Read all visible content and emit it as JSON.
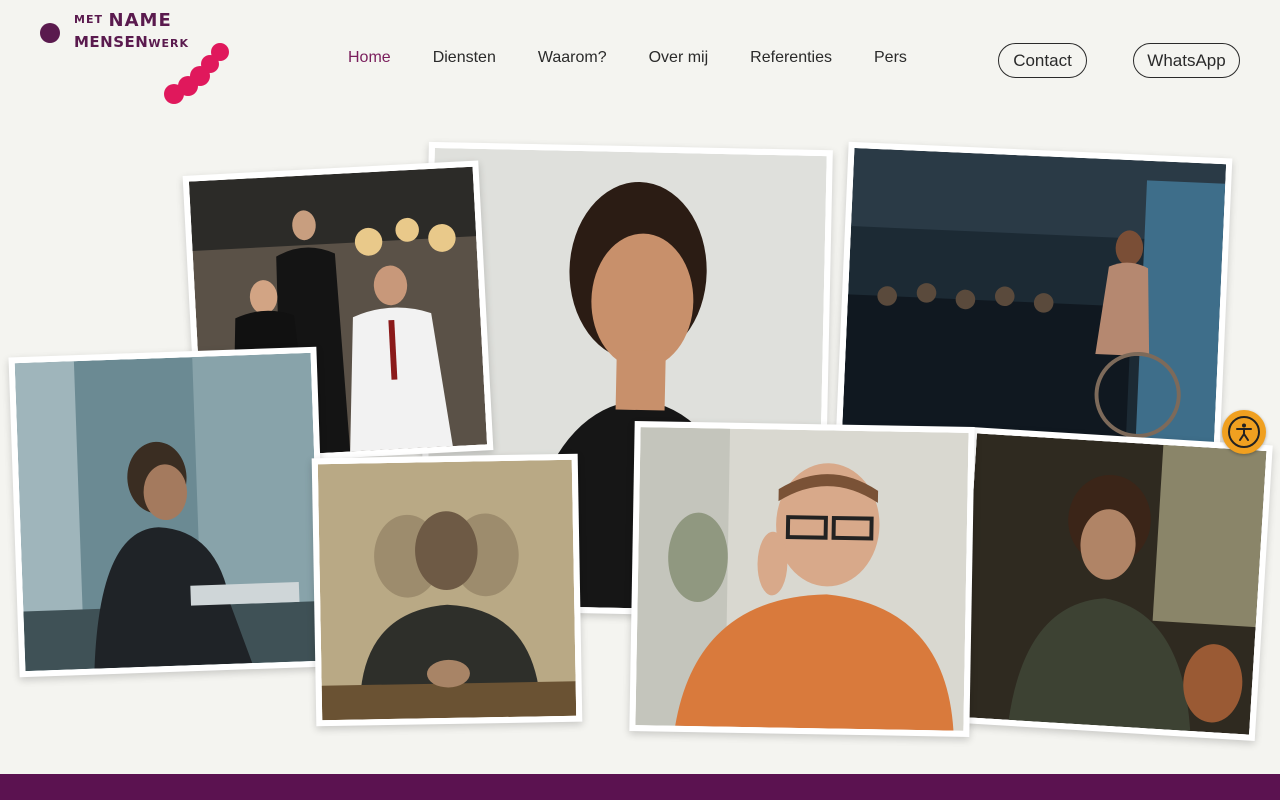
{
  "logo": {
    "met": "MET",
    "name": "NAME",
    "mensen": "MENSEN",
    "werk": "WERK",
    "colors": {
      "purple": "#5a1a4e",
      "pink": "#e0185c"
    }
  },
  "nav": {
    "items": [
      {
        "label": "Home",
        "active": true
      },
      {
        "label": "Diensten"
      },
      {
        "label": "Waarom?"
      },
      {
        "label": "Over mij"
      },
      {
        "label": "Referenties"
      },
      {
        "label": "Pers"
      }
    ]
  },
  "buttons": {
    "contact": "Contact",
    "whatsapp": "WhatsApp"
  },
  "colors": {
    "background": "#f4f4f0",
    "active_nav": "#7a1e5c",
    "footer_band": "#5b1250",
    "accessibility": "#f0a020"
  },
  "icons": {
    "accessibility": "accessibility-icon"
  }
}
